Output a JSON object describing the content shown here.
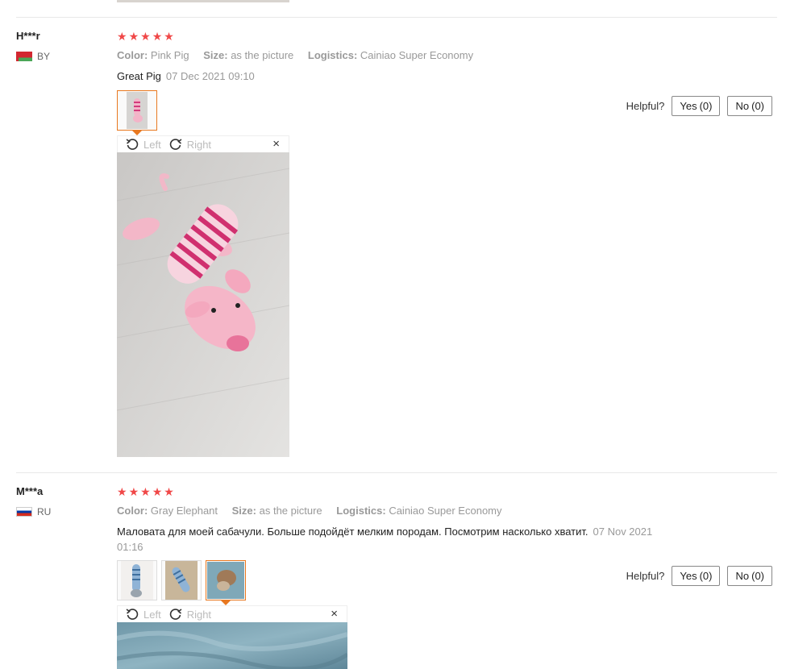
{
  "rating_stars": [
    "★",
    "★",
    "★",
    "★",
    "★"
  ],
  "colors": {
    "star": "#f04848",
    "active_thumb": "#e87820"
  },
  "reviews": [
    {
      "user": "H***r",
      "country": "BY",
      "attrs": {
        "color_label": "Color:",
        "color_value": "Pink Pig",
        "size_label": "Size:",
        "size_value": "as the picture",
        "logistics_label": "Logistics:",
        "logistics_value": "Cainiao Super Economy"
      },
      "text": "Great Pig",
      "date": "07 Dec 2021 09:10",
      "helpful_label": "Helpful?",
      "yes_label": "Yes",
      "yes_count": "(0)",
      "no_label": "No",
      "no_count": "(0)",
      "viewer": {
        "left_label": "Left",
        "right_label": "Right",
        "close": "×"
      },
      "thumbnails": [
        "pink-pig-photo"
      ]
    },
    {
      "user": "M***a",
      "country": "RU",
      "attrs": {
        "color_label": "Color:",
        "color_value": "Gray Elephant",
        "size_label": "Size:",
        "size_value": "as the picture",
        "logistics_label": "Logistics:",
        "logistics_value": "Cainiao Super Economy"
      },
      "text": "Маловата для моей сабачули. Больше подойдёт мелким породам. Посмотрим насколько хватит.",
      "date": "07 Nov 2021 01:16",
      "helpful_label": "Helpful?",
      "yes_label": "Yes",
      "yes_count": "(0)",
      "no_label": "No",
      "no_count": "(0)",
      "viewer": {
        "left_label": "Left",
        "right_label": "Right",
        "close": "×"
      },
      "thumbnails": [
        "elephant-photo-1",
        "elephant-photo-2",
        "elephant-photo-3"
      ]
    }
  ]
}
